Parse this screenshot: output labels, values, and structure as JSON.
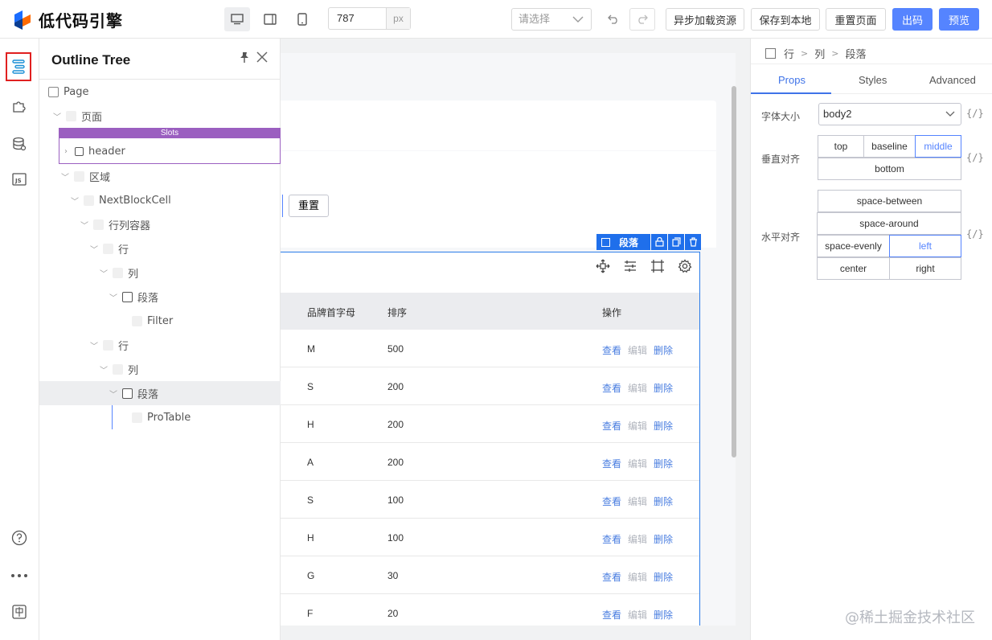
{
  "app": {
    "title": "低代码引擎"
  },
  "toolbar": {
    "width_value": "787",
    "width_unit": "px",
    "select_placeholder": "请选择",
    "async_load_label": "异步加载资源",
    "save_local_label": "保存到本地",
    "reset_page_label": "重置页面",
    "export_label": "出码",
    "preview_label": "预览"
  },
  "outline": {
    "title": "Outline Tree",
    "slots_label": "Slots",
    "nodes": [
      {
        "label": "Page"
      },
      {
        "label": "页面"
      },
      {
        "label": "header"
      },
      {
        "label": "区域"
      },
      {
        "label": "NextBlockCell"
      },
      {
        "label": "行列容器"
      },
      {
        "label": "行"
      },
      {
        "label": "列"
      },
      {
        "label": "段落"
      },
      {
        "label": "Filter"
      },
      {
        "label": "行"
      },
      {
        "label": "列"
      },
      {
        "label": "段落"
      },
      {
        "label": "ProTable"
      }
    ]
  },
  "canvas": {
    "reset_button": "重置",
    "selection_tag": "段落",
    "table": {
      "headers": [
        "品牌首字母",
        "排序",
        "操作"
      ],
      "action_labels": {
        "view": "查看",
        "edit": "编辑",
        "delete": "删除"
      },
      "rows": [
        {
          "letter": "M",
          "order": "500"
        },
        {
          "letter": "S",
          "order": "200"
        },
        {
          "letter": "H",
          "order": "200"
        },
        {
          "letter": "A",
          "order": "200"
        },
        {
          "letter": "S",
          "order": "100"
        },
        {
          "letter": "H",
          "order": "100"
        },
        {
          "letter": "G",
          "order": "30"
        },
        {
          "letter": "F",
          "order": "20"
        }
      ]
    }
  },
  "props": {
    "breadcrumb": [
      "行",
      "列",
      "段落"
    ],
    "tabs": [
      "Props",
      "Styles",
      "Advanced"
    ],
    "font_size_label": "字体大小",
    "font_size_value": "body2",
    "vertical_align_label": "垂直对齐",
    "vertical_align_options": [
      "top",
      "baseline",
      "middle",
      "bottom"
    ],
    "vertical_align_selected": "middle",
    "horizontal_align_label": "水平对齐",
    "horizontal_align_options": [
      "space-between",
      "space-around",
      "space-evenly",
      "left",
      "center",
      "right"
    ],
    "horizontal_align_selected": "left",
    "var_toggle": "{/}"
  },
  "watermark": "@稀土掘金技术社区",
  "colors": {
    "primary": "#5584ff",
    "selection": "#1f6feb",
    "slots": "#9b5fc0",
    "link": "#4a7ee0"
  }
}
